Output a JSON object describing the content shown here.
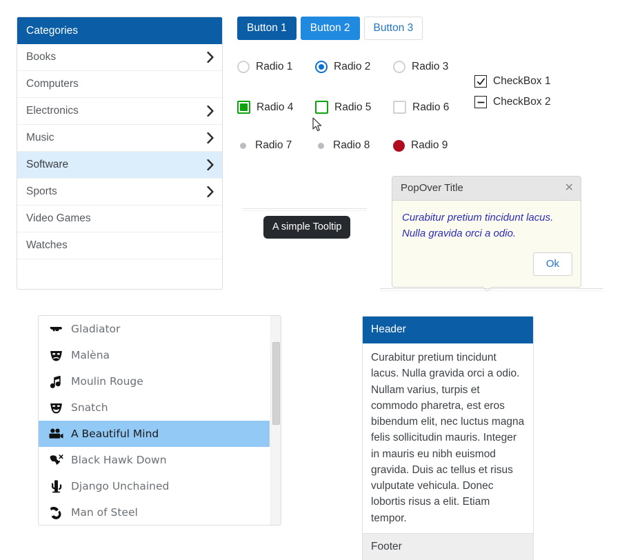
{
  "categories_panel": {
    "header": "Categories",
    "items": [
      {
        "label": "Books",
        "chevron": true,
        "selected": false
      },
      {
        "label": "Computers",
        "chevron": false,
        "selected": false
      },
      {
        "label": "Electronics",
        "chevron": true,
        "selected": false
      },
      {
        "label": "Music",
        "chevron": true,
        "selected": false
      },
      {
        "label": "Software",
        "chevron": true,
        "selected": true
      },
      {
        "label": "Sports",
        "chevron": true,
        "selected": false
      },
      {
        "label": "Video Games",
        "chevron": false,
        "selected": false
      },
      {
        "label": "Watches",
        "chevron": false,
        "selected": false
      }
    ]
  },
  "buttons": [
    {
      "label": "Button 1",
      "style": "primary"
    },
    {
      "label": "Button 2",
      "style": "info"
    },
    {
      "label": "Button 3",
      "style": "default"
    }
  ],
  "radios_row1": [
    {
      "label": "Radio 1",
      "checked": false
    },
    {
      "label": "Radio 2",
      "checked": true
    },
    {
      "label": "Radio 3",
      "checked": false
    }
  ],
  "radios_row2": [
    {
      "label": "Radio 4",
      "state": "filled-green"
    },
    {
      "label": "Radio 5",
      "state": "empty-green"
    },
    {
      "label": "Radio 6",
      "state": "empty-grey"
    }
  ],
  "radios_row3": [
    {
      "label": "Radio 7",
      "dot": "small-grey"
    },
    {
      "label": "Radio 8",
      "dot": "small-grey"
    },
    {
      "label": "Radio 9",
      "dot": "big-red"
    }
  ],
  "checkboxes": [
    {
      "label": "CheckBox 1",
      "state": "checked"
    },
    {
      "label": "CheckBox 2",
      "state": "indeterminate"
    }
  ],
  "tooltip": {
    "text": "A simple Tooltip"
  },
  "popover": {
    "title": "PopOver Title",
    "close_icon": "close-icon",
    "body": "Curabitur pretium tincidunt lacus. Nulla gravida orci a odio.",
    "ok_label": "Ok"
  },
  "movies": {
    "items": [
      {
        "label": "Gladiator",
        "icon": "gun-icon",
        "selected": false
      },
      {
        "label": "Malèna",
        "icon": "sad-mask-icon",
        "selected": false
      },
      {
        "label": "Moulin Rouge",
        "icon": "music-note-icon",
        "selected": false
      },
      {
        "label": "Snatch",
        "icon": "happy-mask-icon",
        "selected": false
      },
      {
        "label": "A Beautiful Mind",
        "icon": "movie-camera-icon",
        "selected": true
      },
      {
        "label": "Black Hawk Down",
        "icon": "helicopter-icon",
        "selected": false
      },
      {
        "label": "Django Unchained",
        "icon": "cactus-icon",
        "selected": false
      },
      {
        "label": "Man of Steel",
        "icon": "cape-icon",
        "selected": false
      }
    ]
  },
  "panel": {
    "header": "Header",
    "body": "Curabitur pretium tincidunt lacus. Nulla gravida orci a odio. Nullam varius, turpis et commodo pharetra, est eros bibendum elit, nec luctus magna felis sollicitudin mauris. Integer in mauris eu nibh euismod gravida. Duis ac tellus et risus vulputate vehicula. Donec lobortis risus a elit. Etiam tempor.",
    "footer": "Footer"
  },
  "colors": {
    "brand_blue": "#0b5ea5",
    "info_blue": "#2089e0",
    "selection_blue": "#92c9f5",
    "soft_blue": "#dcedfb",
    "green": "#0ca30c",
    "red": "#b00b1e",
    "tooltip_bg": "#262a2e",
    "popover_bg": "#fbfbef",
    "popover_text": "#2b2bbb"
  }
}
